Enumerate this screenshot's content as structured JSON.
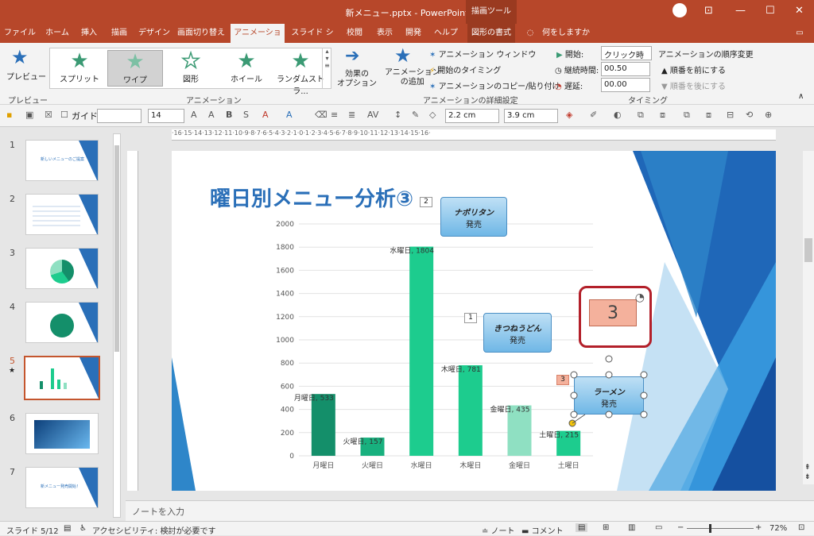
{
  "window": {
    "title": "新メニュー.pptx  -  PowerPoint",
    "tool_tab": "描画ツール"
  },
  "tabs": [
    "ファイル",
    "ホーム",
    "挿入",
    "描画",
    "デザイン",
    "画面切り替え",
    "アニメーション",
    "スライド ショー",
    "校閲",
    "表示",
    "開発",
    "ヘルプ",
    "図形の書式"
  ],
  "tell_me": "何をしますか",
  "ribbon": {
    "preview": "プレビュー",
    "preview_group": "プレビュー",
    "animations": [
      "スプリット",
      "ワイプ",
      "図形",
      "ホイール",
      "ランダムストラ..."
    ],
    "animation_group": "アニメーション",
    "effect_options": "効果の\nオプション",
    "add_animation": "アニメーション\nの追加",
    "animation_window": "アニメーション ウィンドウ",
    "trigger": "開始のタイミング",
    "painter": "アニメーションのコピー/貼り付け",
    "advanced_group": "アニメーションの詳細設定",
    "start_label": "開始:",
    "start_value": "クリック時",
    "duration_label": "継続時間:",
    "duration_value": "00.50",
    "delay_label": "遅延:",
    "delay_value": "00.00",
    "reorder": "アニメーションの順序変更",
    "move_earlier": "順番を前にする",
    "move_later": "順番を後にする",
    "timing_group": "タイミング"
  },
  "format": {
    "guide": "ガイド",
    "font_size": "14",
    "width": "2.2 cm",
    "height": "3.9 cm"
  },
  "ruler_h": "·16·15·14·13·12·11·10·9·8·7·6·5·4·3·2·1·0·1·2·3·4·5·6·7·8·9·10·11·12·13·14·15·16·",
  "slides": {
    "numbers": [
      "1",
      "2",
      "3",
      "4",
      "5",
      "6",
      "7"
    ],
    "selected": "5",
    "thumb_titles": [
      "新しいメニューのご提案",
      "",
      "",
      "",
      "",
      "",
      "新メニュー発売開始！"
    ]
  },
  "slide": {
    "title": "曜日別メニュー分析③",
    "callouts": [
      {
        "name": "ナポリタン",
        "sub": "発売",
        "tag": "2"
      },
      {
        "name": "きつねうどん",
        "sub": "発売",
        "tag": "1"
      },
      {
        "name": "ラーメン",
        "sub": "発売",
        "tag": "3"
      }
    ],
    "zoom_badge": "3"
  },
  "chart_data": {
    "type": "bar",
    "categories": [
      "月曜日",
      "火曜日",
      "水曜日",
      "木曜日",
      "金曜日",
      "土曜日"
    ],
    "values": [
      533,
      157,
      1804,
      781,
      435,
      215
    ],
    "data_labels": [
      "月曜日, 533",
      "火曜日, 157",
      "水曜日, 1804",
      "木曜日, 781",
      "金曜日, 435",
      "土曜日, 215"
    ],
    "colors": [
      "#148f6a",
      "#18b07e",
      "#1dcc8e",
      "#1dcc8e",
      "#8fe0c2",
      "#1dcc8e"
    ],
    "ylim": [
      0,
      2000
    ],
    "yticks": [
      0,
      200,
      400,
      600,
      800,
      1000,
      1200,
      1400,
      1600,
      1800,
      2000
    ],
    "grid": true
  },
  "notes": "ノートを入力",
  "status": {
    "slide": "スライド 5/12",
    "accessibility": "アクセシビリティ: 検討が必要です",
    "notes": "ノート",
    "comments": "コメント",
    "zoom": "72%"
  }
}
